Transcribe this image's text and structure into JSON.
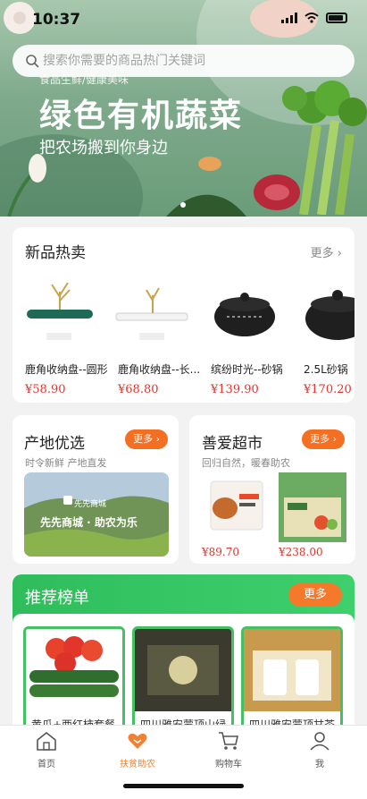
{
  "status": {
    "time": "10:37"
  },
  "search": {
    "placeholder": "搜索你需要的商品热门关键词"
  },
  "hero": {
    "small_text": "食品生鲜/健康美味",
    "title": "绿色有机蔬菜",
    "subtitle": "把农场搬到你身边"
  },
  "new_products": {
    "title": "新品热卖",
    "more": "更多 ›",
    "items": [
      {
        "name": "鹿角收纳盘--圆形",
        "price": "¥58.90"
      },
      {
        "name": "鹿角收纳盘--长...",
        "price": "¥68.80"
      },
      {
        "name": "缤纷时光--砂锅",
        "price": "¥139.90"
      },
      {
        "name": "2.5L砂锅",
        "price": "¥170.20"
      }
    ]
  },
  "origin": {
    "title": "产地优选",
    "more": "更多 ›",
    "note": "时令新鲜 产地直发",
    "banner_brand": "先先商城",
    "banner_text": "先先商城 · 助农为乐"
  },
  "supermarket": {
    "title": "善爱超市",
    "more": "更多 ›",
    "note": "回归自然，暖春助农",
    "items": [
      {
        "price": "¥89.70"
      },
      {
        "price": "¥238.00"
      }
    ]
  },
  "ranking": {
    "title": "推荐榜单",
    "more": "更多",
    "items": [
      {
        "name": "黄瓜+西红柿套餐"
      },
      {
        "name": "四川雅安蒙顶山绿"
      },
      {
        "name": "四川雅安蒙顶甘茶"
      }
    ]
  },
  "tabbar": {
    "items": [
      {
        "label": "首页"
      },
      {
        "label": "扶贫助农"
      },
      {
        "label": "购物车"
      },
      {
        "label": "我"
      }
    ]
  },
  "colors": {
    "accent_orange": "#f08133",
    "price_red": "#e2352e",
    "ranking_green": "#3ed06d"
  }
}
